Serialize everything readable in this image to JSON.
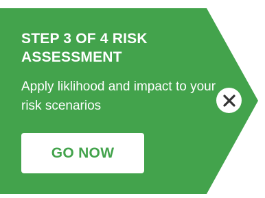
{
  "tour_step": {
    "title": "STEP 3 OF 4 RISK ASSESSMENT",
    "description": "Apply liklihood and impact to your risk scenarios",
    "button_label": "GO NOW",
    "close_icon": "close-icon"
  },
  "colors": {
    "banner_green": "#43a34c",
    "text_white": "#ffffff",
    "close_x": "#333333"
  }
}
